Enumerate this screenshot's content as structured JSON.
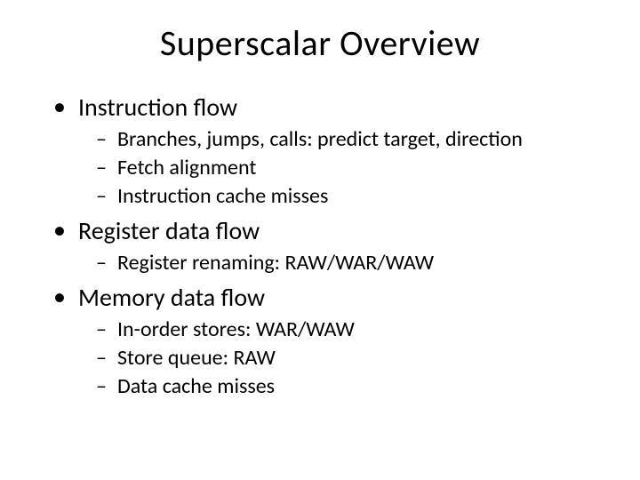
{
  "title": "Superscalar Overview",
  "bullets": [
    {
      "text": "Instruction flow",
      "sub": [
        "Branches, jumps, calls: predict target, direction",
        "Fetch alignment",
        "Instruction cache misses"
      ]
    },
    {
      "text": "Register data flow",
      "sub": [
        "Register renaming: RAW/WAR/WAW"
      ]
    },
    {
      "text": "Memory data flow",
      "sub": [
        "In-order stores: WAR/WAW",
        "Store queue: RAW",
        "Data cache misses"
      ]
    }
  ]
}
